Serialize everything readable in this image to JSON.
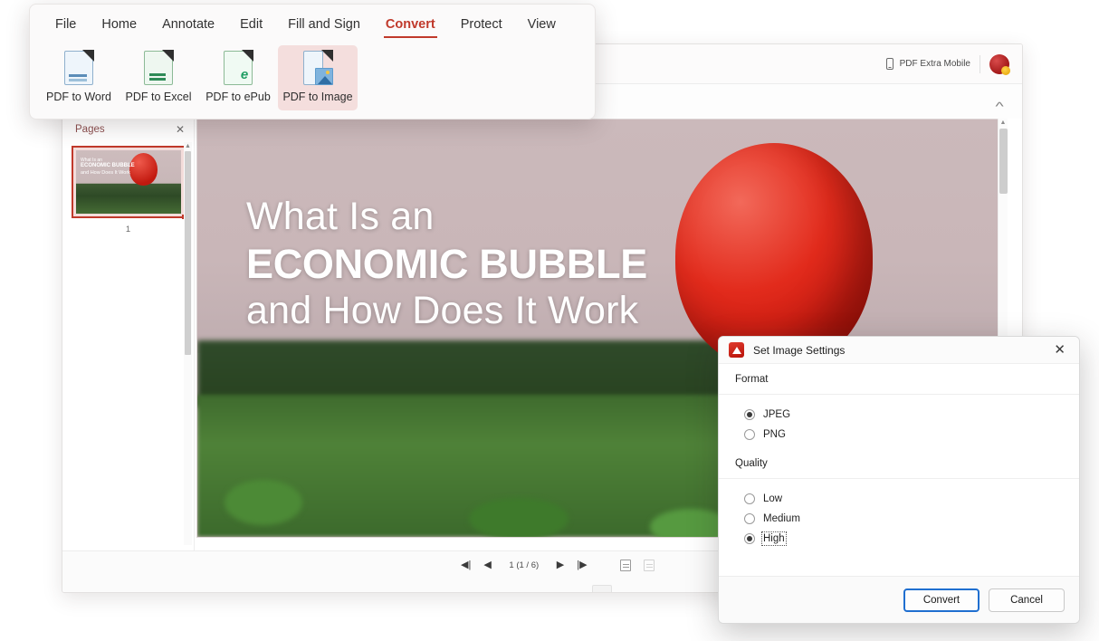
{
  "app": {
    "titlebar": {
      "mobile_label": "PDF Extra Mobile",
      "mobile_icon": "phone-icon",
      "avatar_icon": "user-avatar"
    },
    "collapse_icon": "chevron-up-icon"
  },
  "ribbon": {
    "tabs": [
      {
        "label": "File",
        "active": false
      },
      {
        "label": "Home",
        "active": false
      },
      {
        "label": "Annotate",
        "active": false
      },
      {
        "label": "Edit",
        "active": false
      },
      {
        "label": "Fill and Sign",
        "active": false
      },
      {
        "label": "Convert",
        "active": true
      },
      {
        "label": "Protect",
        "active": false
      },
      {
        "label": "View",
        "active": false
      }
    ],
    "items": [
      {
        "label": "PDF to Word",
        "icon": "pdf-to-word-icon",
        "selected": false
      },
      {
        "label": "PDF to Excel",
        "icon": "pdf-to-excel-icon",
        "selected": false
      },
      {
        "label": "PDF to ePub",
        "icon": "pdf-to-epub-icon",
        "selected": false
      },
      {
        "label": "PDF to Image",
        "icon": "pdf-to-image-icon",
        "selected": true
      }
    ],
    "accent_color": "#c0392b",
    "selected_bg": "#f4dedd"
  },
  "pages_panel": {
    "title": "Pages",
    "close_icon": "close-icon",
    "thumbnail": {
      "page_number": "1",
      "line1": "What Is an",
      "line2": "ECONOMIC BUBBLE",
      "line3": "and How Does It Work"
    }
  },
  "document": {
    "title_line1": "What Is an",
    "title_line2": "ECONOMIC BUBBLE",
    "title_line3": "and How Does It Work"
  },
  "bottom_bar": {
    "first_page_icon": "first-page-icon",
    "prev_page_icon": "previous-page-icon",
    "page_indicator": "1 (1 / 6)",
    "next_page_icon": "next-page-icon",
    "last_page_icon": "last-page-icon",
    "single_page_view_icon": "single-page-view-icon",
    "continuous_view_icon": "continuous-page-view-icon"
  },
  "dialog": {
    "title": "Set Image Settings",
    "app_icon": "pdf-extra-app-icon",
    "close_icon": "close-icon",
    "format": {
      "heading": "Format",
      "options": [
        {
          "label": "JPEG",
          "selected": true,
          "focused": false
        },
        {
          "label": "PNG",
          "selected": false,
          "focused": false
        }
      ]
    },
    "quality": {
      "heading": "Quality",
      "options": [
        {
          "label": "Low",
          "selected": false,
          "focused": false
        },
        {
          "label": "Medium",
          "selected": false,
          "focused": false
        },
        {
          "label": "High",
          "selected": true,
          "focused": true
        }
      ]
    },
    "buttons": {
      "confirm": "Convert",
      "cancel": "Cancel"
    },
    "focus_color": "#1f6fd0"
  }
}
